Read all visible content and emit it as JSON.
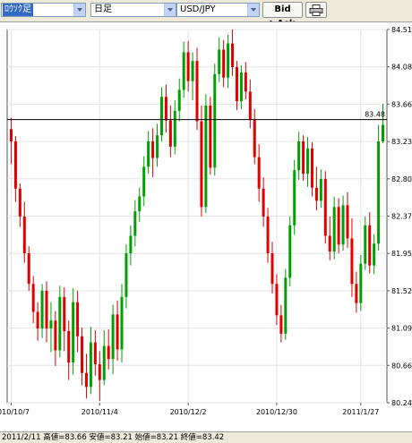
{
  "toolbar": {
    "chart_type": "ﾛｳｿｸ足",
    "period": "日足",
    "symbol": "USD/JPY",
    "bid_ask_label": "Bid ▶Ask",
    "print_icon": "printer-icon"
  },
  "chart_data": {
    "type": "candlestick",
    "title": "",
    "ylim": [
      80.24,
      84.51
    ],
    "yticks": [
      "84.51",
      "84.08",
      "83.66",
      "83.23",
      "82.80",
      "82.37",
      "81.95",
      "81.52",
      "81.09",
      "80.66",
      "80.24"
    ],
    "xticks": [
      "2010/10/7",
      "2010/11/4",
      "2010/12/2",
      "2010/12/30",
      "2011/1/27"
    ],
    "current_price_label": "83.48",
    "current_price": 83.48,
    "up_color": "#00a000",
    "down_color": "#e00000",
    "candles_ohlc": [
      [
        83.37,
        83.5,
        82.97,
        83.23
      ],
      [
        83.23,
        83.29,
        82.54,
        82.69
      ],
      [
        82.69,
        82.75,
        82.25,
        82.37
      ],
      [
        82.37,
        82.54,
        81.84,
        81.95
      ],
      [
        81.95,
        82.03,
        81.52,
        81.6
      ],
      [
        81.6,
        81.69,
        81.15,
        81.28
      ],
      [
        81.28,
        81.39,
        80.95,
        81.09
      ],
      [
        81.09,
        81.6,
        80.98,
        81.52
      ],
      [
        81.52,
        81.63,
        80.93,
        81.09
      ],
      [
        81.09,
        81.39,
        80.82,
        81.18
      ],
      [
        81.18,
        81.29,
        80.66,
        80.84
      ],
      [
        80.84,
        81.58,
        80.76,
        81.45
      ],
      [
        81.45,
        81.56,
        80.83,
        81.06
      ],
      [
        81.06,
        81.18,
        80.5,
        80.7
      ],
      [
        80.7,
        81.55,
        80.56,
        81.39
      ],
      [
        81.39,
        81.52,
        80.82,
        81.0
      ],
      [
        81.0,
        81.1,
        80.44,
        80.58
      ],
      [
        80.58,
        80.8,
        80.29,
        80.42
      ],
      [
        80.42,
        81.11,
        80.34,
        80.93
      ],
      [
        80.93,
        81.07,
        80.55,
        80.68
      ],
      [
        80.68,
        80.83,
        80.26,
        80.5
      ],
      [
        80.5,
        81.07,
        80.44,
        80.89
      ],
      [
        80.89,
        81.08,
        80.62,
        80.74
      ],
      [
        80.74,
        81.36,
        80.57,
        81.25
      ],
      [
        81.25,
        81.41,
        80.72,
        80.85
      ],
      [
        80.85,
        81.6,
        80.7,
        81.45
      ],
      [
        81.45,
        82.05,
        81.32,
        81.95
      ],
      [
        81.95,
        82.27,
        81.81,
        82.15
      ],
      [
        82.15,
        82.56,
        82.03,
        82.43
      ],
      [
        82.43,
        82.7,
        82.31,
        82.6
      ],
      [
        82.6,
        83.06,
        82.49,
        82.94
      ],
      [
        82.94,
        83.35,
        82.86,
        83.23
      ],
      [
        83.23,
        83.38,
        82.82,
        83.04
      ],
      [
        83.04,
        83.43,
        82.94,
        83.3
      ],
      [
        83.3,
        83.85,
        83.23,
        83.74
      ],
      [
        83.74,
        83.88,
        83.33,
        83.47
      ],
      [
        83.47,
        83.64,
        83.05,
        83.17
      ],
      [
        83.17,
        83.7,
        83.08,
        83.58
      ],
      [
        83.58,
        83.95,
        83.46,
        83.82
      ],
      [
        83.82,
        84.37,
        83.73,
        84.25
      ],
      [
        84.25,
        84.38,
        83.8,
        83.92
      ],
      [
        83.92,
        84.25,
        83.7,
        84.15
      ],
      [
        84.15,
        84.3,
        83.36,
        83.46
      ],
      [
        83.46,
        83.64,
        82.37,
        82.48
      ],
      [
        82.48,
        83.77,
        82.41,
        83.64
      ],
      [
        83.64,
        83.74,
        82.85,
        82.93
      ],
      [
        82.93,
        84.12,
        82.84,
        84.0
      ],
      [
        84.0,
        84.42,
        83.91,
        84.28
      ],
      [
        84.28,
        84.39,
        83.85,
        83.96
      ],
      [
        83.96,
        84.45,
        83.84,
        84.35
      ],
      [
        84.35,
        84.51,
        83.98,
        84.08
      ],
      [
        84.08,
        84.15,
        83.59,
        83.69
      ],
      [
        83.69,
        84.1,
        83.6,
        84.02
      ],
      [
        84.02,
        84.14,
        83.71,
        83.8
      ],
      [
        83.8,
        83.94,
        83.38,
        83.48
      ],
      [
        83.48,
        83.6,
        82.97,
        83.05
      ],
      [
        83.05,
        83.2,
        82.54,
        82.69
      ],
      [
        82.69,
        82.82,
        82.25,
        82.37
      ],
      [
        82.37,
        82.47,
        81.84,
        81.95
      ],
      [
        81.95,
        82.08,
        81.49,
        81.6
      ],
      [
        81.6,
        81.71,
        81.13,
        81.24
      ],
      [
        81.24,
        81.36,
        80.93,
        81.03
      ],
      [
        81.03,
        81.77,
        80.96,
        81.67
      ],
      [
        81.67,
        82.37,
        81.57,
        82.27
      ],
      [
        82.27,
        83.02,
        82.16,
        82.9
      ],
      [
        82.9,
        83.34,
        82.79,
        83.23
      ],
      [
        83.23,
        83.3,
        82.78,
        82.86
      ],
      [
        82.86,
        83.28,
        82.71,
        83.15
      ],
      [
        83.15,
        83.22,
        82.6,
        82.7
      ],
      [
        82.7,
        82.94,
        82.44,
        82.55
      ],
      [
        82.55,
        82.91,
        82.47,
        82.8
      ],
      [
        82.8,
        82.89,
        82.06,
        82.15
      ],
      [
        82.15,
        82.37,
        81.87,
        81.97
      ],
      [
        81.97,
        82.6,
        81.88,
        82.48
      ],
      [
        82.48,
        82.58,
        81.95,
        82.05
      ],
      [
        82.05,
        82.61,
        81.98,
        82.5
      ],
      [
        82.5,
        82.65,
        82.01,
        82.12
      ],
      [
        82.12,
        82.35,
        81.45,
        81.6
      ],
      [
        81.6,
        81.74,
        81.27,
        81.38
      ],
      [
        81.38,
        81.93,
        81.29,
        81.83
      ],
      [
        81.83,
        82.37,
        81.76,
        82.27
      ],
      [
        82.27,
        82.42,
        81.72,
        81.81
      ],
      [
        81.81,
        82.17,
        81.71,
        82.06
      ],
      [
        82.06,
        83.42,
        81.98,
        83.23
      ],
      [
        83.23,
        83.66,
        83.21,
        83.42
      ]
    ]
  },
  "status": {
    "text": "2011/2/11 高値=83.66 安値=83.21 始値=83.21 終値=83.42"
  }
}
